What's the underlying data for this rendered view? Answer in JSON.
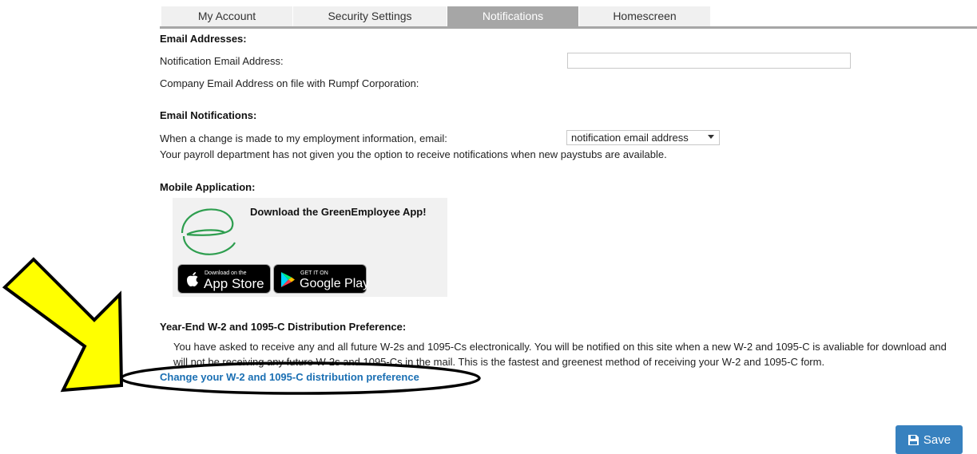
{
  "tabs": [
    {
      "label": "My Account",
      "active": false
    },
    {
      "label": "Security Settings",
      "active": false
    },
    {
      "label": "Notifications",
      "active": true
    },
    {
      "label": "Homescreen",
      "active": false
    }
  ],
  "email_addresses": {
    "title": "Email Addresses:",
    "notification_label": "Notification Email Address:",
    "notification_value": "",
    "company_label": "Company Email Address on file with Rumpf Corporation:"
  },
  "email_notifications": {
    "title": "Email Notifications:",
    "change_label": "When a change is made to my employment information, email:",
    "change_select_value": "notification email address",
    "paystub_note": "Your payroll department has not given you the option to receive notifications when new paystubs are available."
  },
  "mobile": {
    "title": "Mobile Application:",
    "app_title": "Download the GreenEmployee App!",
    "app_store_small": "Download on the",
    "app_store_big": "App Store",
    "google_small": "GET IT ON",
    "google_big": "Google Play"
  },
  "year_end": {
    "title": "Year-End W-2 and 1095-C Distribution Preference:",
    "text": "You have asked to receive any and all future W-2s and 1095-Cs electronically. You will be notified on this site when a new W-2 and 1095-C is avaliable for download and will not be receiving any future W-2s and 1095-Cs in the mail. This is the fastest and greenest method of receiving your W-2 and 1095-C form.",
    "link": "Change your W-2 and 1095-C distribution preference"
  },
  "save_label": "Save",
  "colors": {
    "active_tab": "#a6a6a6",
    "link": "#1a6fb3",
    "save_button": "#3781bf",
    "annotation_arrow": "#ffff00",
    "brand_green": "#2e9e4f"
  },
  "icons": {
    "save": "floppy-disk-icon",
    "apple": "apple-icon",
    "google_play": "google-play-icon",
    "logo": "greenemployee-logo"
  }
}
